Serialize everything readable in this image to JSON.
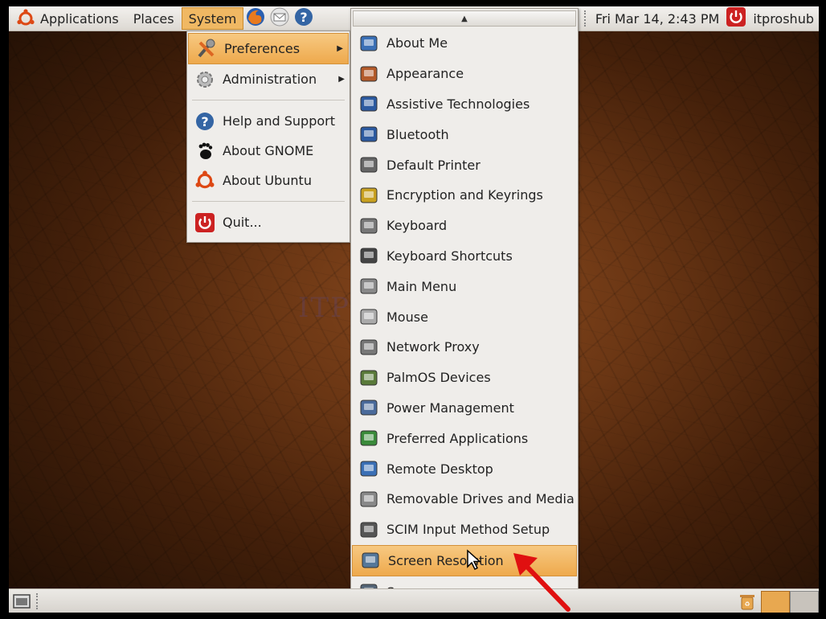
{
  "top_panel": {
    "menus": [
      "Applications",
      "Places",
      "System"
    ],
    "clock": "Fri Mar 14,  2:43 PM",
    "user": "itproshub"
  },
  "system_menu": {
    "items": [
      {
        "label": "Preferences",
        "icon": "preferences-icon",
        "submenu": true
      },
      {
        "label": "Administration",
        "icon": "gear-icon",
        "submenu": true
      },
      {
        "label": "Help and Support",
        "icon": "help-icon"
      },
      {
        "label": "About GNOME",
        "icon": "gnome-foot-icon"
      },
      {
        "label": "About Ubuntu",
        "icon": "ubuntu-logo-icon"
      },
      {
        "label": "Quit...",
        "icon": "power-icon"
      }
    ]
  },
  "preferences_menu": {
    "items": [
      "About Me",
      "Appearance",
      "Assistive Technologies",
      "Bluetooth",
      "Default Printer",
      "Encryption and Keyrings",
      "Keyboard",
      "Keyboard Shortcuts",
      "Main Menu",
      "Mouse",
      "Network Proxy",
      "PalmOS Devices",
      "Power Management",
      "Preferred Applications",
      "Remote Desktop",
      "Removable Drives and Media",
      "SCIM Input Method Setup",
      "Screen Resolution",
      "Screensaver"
    ],
    "highlighted": "Screen Resolution"
  },
  "watermark": "ITPROSHUB",
  "colors": {
    "highlight": "#f0b863",
    "accent_red": "#cc2222"
  }
}
